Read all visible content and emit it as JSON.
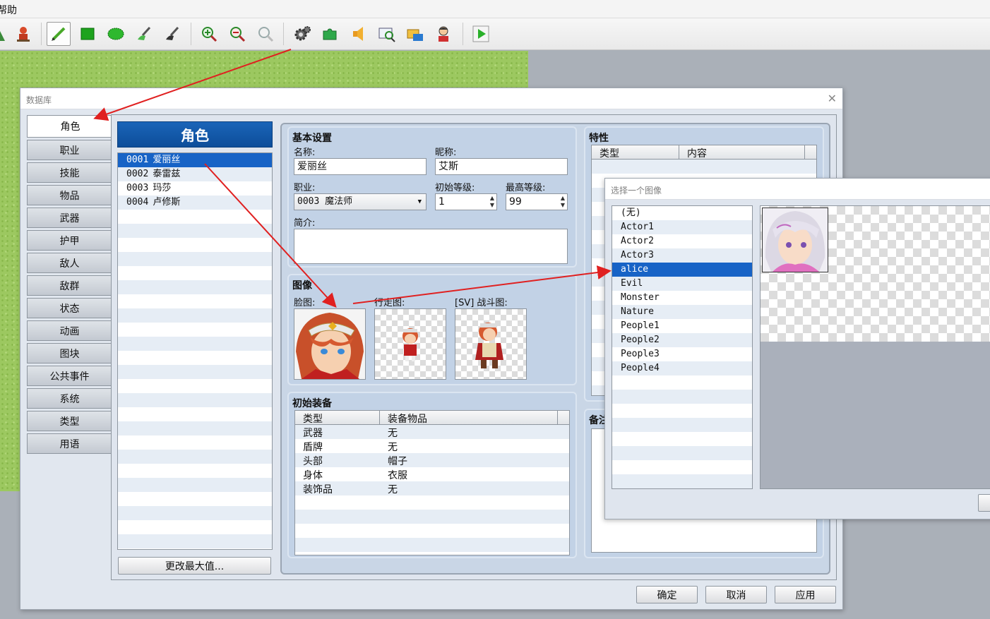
{
  "menubar": {
    "help": "帮助"
  },
  "toolbar": {
    "tools": [
      {
        "name": "terrain-tool",
        "x": 0
      },
      {
        "name": "event-tool",
        "x": 18
      }
    ]
  },
  "database": {
    "title": "数据库",
    "tabs": [
      "角色",
      "职业",
      "技能",
      "物品",
      "武器",
      "护甲",
      "敌人",
      "敌群",
      "状态",
      "动画",
      "图块",
      "公共事件",
      "系统",
      "类型",
      "用语"
    ],
    "actor_header": "角色",
    "actors": [
      {
        "id": "0001",
        "name": "爱丽丝"
      },
      {
        "id": "0002",
        "name": "泰雷兹"
      },
      {
        "id": "0003",
        "name": "玛莎"
      },
      {
        "id": "0004",
        "name": "卢修斯"
      }
    ],
    "change_max_button": "更改最大值...",
    "basic": {
      "title": "基本设置",
      "name_label": "名称:",
      "name_value": "爱丽丝",
      "nickname_label": "昵称:",
      "nickname_value": "艾斯",
      "class_label": "职业:",
      "class_value": "0003 魔法师",
      "initial_level_label": "初始等级:",
      "initial_level_value": "1",
      "max_level_label": "最高等级:",
      "max_level_value": "99",
      "profile_label": "简介:"
    },
    "images": {
      "title": "图像",
      "face_label": "脸图:",
      "character_label": "行走图:",
      "battler_label": "[SV] 战斗图:"
    },
    "equipment": {
      "title": "初始装备",
      "col_type": "类型",
      "col_item": "装备物品",
      "rows": [
        {
          "type": "武器",
          "item": "无"
        },
        {
          "type": "盾牌",
          "item": "无"
        },
        {
          "type": "头部",
          "item": "帽子"
        },
        {
          "type": "身体",
          "item": "衣服"
        },
        {
          "type": "装饰品",
          "item": "无"
        }
      ]
    },
    "traits": {
      "title": "特性",
      "col_type": "类型",
      "col_content": "内容"
    },
    "note": {
      "title": "备注"
    },
    "buttons": {
      "ok": "确定",
      "cancel": "取消",
      "apply": "应用"
    }
  },
  "picker": {
    "title": "选择一个图像",
    "files": [
      "(无)",
      "Actor1",
      "Actor2",
      "Actor3",
      "alice",
      "Evil",
      "Monster",
      "Nature",
      "People1",
      "People2",
      "People3",
      "People4"
    ],
    "selected": "alice"
  },
  "colors": {
    "selection": "#1763c6",
    "header_blue": "#1a64b8",
    "arrow_red": "#e02020"
  }
}
